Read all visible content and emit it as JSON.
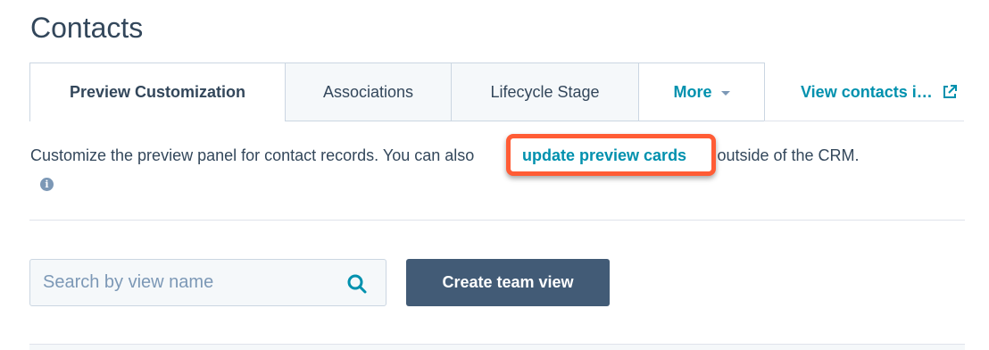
{
  "page": {
    "title": "Contacts"
  },
  "tabs": [
    {
      "label": "Preview Customization",
      "active": true
    },
    {
      "label": "Associations",
      "active": false
    },
    {
      "label": "Lifecycle Stage",
      "active": false
    },
    {
      "label": "More",
      "active": false
    }
  ],
  "view_link": {
    "label": "View contacts i…",
    "icon": "external-link-icon"
  },
  "description": {
    "prefix": "Customize the preview panel for contact records. You can als",
    "hidden_char": "o",
    "link": "update preview cards",
    "suffix": " that appear outside of the CRM.",
    "info_icon": "info-icon"
  },
  "search": {
    "placeholder": "Search by view name",
    "value": "",
    "icon": "search-icon"
  },
  "buttons": {
    "create_team_view": "Create team view"
  },
  "colors": {
    "accent": "#0091ae",
    "highlight": "#ff5c35",
    "primary_button": "#425b76",
    "text": "#33475b"
  }
}
